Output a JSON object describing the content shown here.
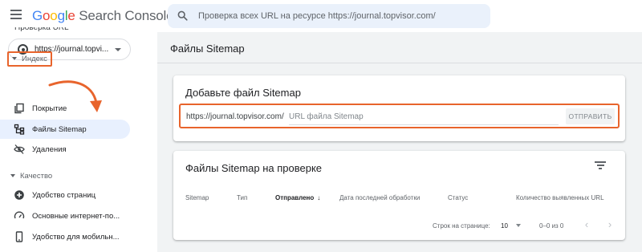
{
  "header": {
    "logo_google": [
      "G",
      "o",
      "o",
      "g",
      "l",
      "e"
    ],
    "logo_rest": "Search Console",
    "search_placeholder": "Проверка всех URL на ресурсе https://journal.topvisor.com/"
  },
  "sidebar": {
    "property": "https://journal.topvi...",
    "cut_item": "Проверка URL",
    "index_section": "Индекс",
    "index_items": [
      {
        "label": "Покрытие",
        "icon": "coverage-icon"
      },
      {
        "label": "Файлы Sitemap",
        "icon": "sitemap-icon"
      },
      {
        "label": "Удаления",
        "icon": "removals-icon"
      }
    ],
    "quality_section": "Качество",
    "quality_items": [
      {
        "label": "Удобство страниц",
        "icon": "page-experience-icon"
      },
      {
        "label": "Основные интернет-по...",
        "icon": "core-web-vitals-icon"
      },
      {
        "label": "Удобство для мобильн...",
        "icon": "mobile-usability-icon"
      }
    ]
  },
  "main": {
    "page_title": "Файлы Sitemap",
    "add_card": {
      "title": "Добавьте файл Sitemap",
      "prefix": "https://journal.topvisor.com/",
      "input_placeholder": "URL файла Sitemap",
      "submit_label": "ОТПРАВИТЬ"
    },
    "list_card": {
      "title": "Файлы Sitemap на проверке",
      "columns": [
        "Sitemap",
        "Тип",
        "Отправлено",
        "Дата последней обработки",
        "Статус",
        "Количество выявленных URL"
      ],
      "sort_arrow": "↓",
      "rows_per_page_label": "Строк на странице:",
      "rows_per_page_value": "10",
      "range": "0–0 из 0"
    }
  },
  "colors": {
    "accent_orange": "#e8642c",
    "active_nav_bg": "#e8f0fe",
    "search_bg": "#eaf1fb",
    "main_bg": "#f1f3f4"
  }
}
